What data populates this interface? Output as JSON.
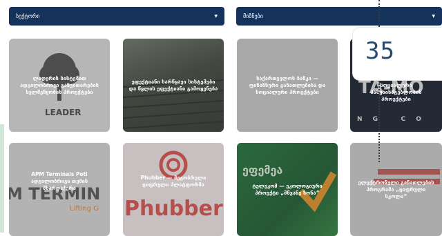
{
  "filters": {
    "left_label": "სექტორი",
    "right_label": "მიზნები"
  },
  "cards": [
    {
      "text": "ლიდერის სისტემით ადგილობრივი განვითარების ხელშეწყობის პროექტები",
      "logo": "LEADER"
    },
    {
      "text": "ეფექტიანი სარწყავი სისტემები და წყლის ეფექტიანი გამოყენება"
    },
    {
      "text": "საქართველოს ბანკი — ფინანსური განათლებისა და სოციალური პროექტები"
    },
    {
      "text": "სოციალური პასუხისმგებლობის პროექტები",
      "logo_lines": [
        "TA-MO",
        "N G   C O"
      ]
    },
    {
      "text": "APM Terminals Poti ადგილობრივი თემის მხარდაჭერა",
      "logo": "M TERMIN",
      "logo_sub": "Lifting G"
    },
    {
      "text": "Phubber — მეგობრული ციფრული პლატფორმა",
      "logo": "Phubber"
    },
    {
      "text": "ტელეკომ — ეკოლოგიური პროექტი „მწვანე ზონა“",
      "logo": "ეფემეა"
    },
    {
      "text": "ელექტრონული განათლების პროგრამა „ციფრული სკოლა“"
    }
  ],
  "badge": {
    "number": "35"
  },
  "colors": {
    "navy": "#14325a",
    "overlay": "#8a8a8a"
  }
}
